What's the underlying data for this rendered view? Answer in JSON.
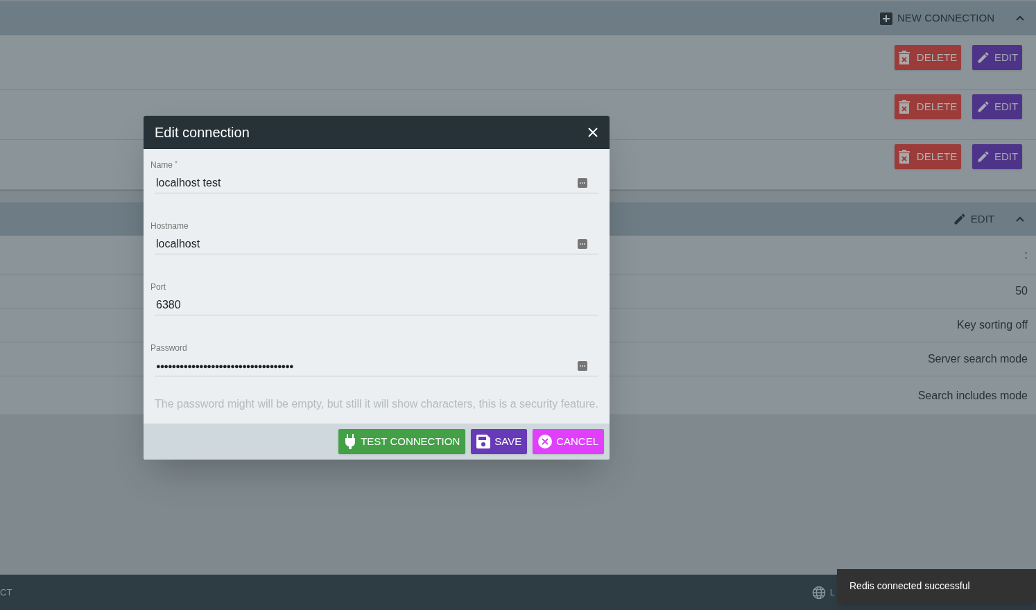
{
  "header": {
    "new_connection": "NEW CONNECTION"
  },
  "connections": [
    {
      "delete": "DELETE",
      "edit": "EDIT"
    },
    {
      "delete": "DELETE",
      "edit": "EDIT"
    },
    {
      "delete": "DELETE",
      "edit": "EDIT"
    }
  ],
  "settings": {
    "edit": "EDIT",
    "rows": [
      ":",
      "50",
      "Key sorting off",
      "Server search mode",
      "Search includes mode"
    ]
  },
  "footer": {
    "left": "CT",
    "right": "L"
  },
  "toast": "Redis connected successful",
  "dialog": {
    "title": "Edit connection",
    "fields": [
      {
        "label": "Name $^{*}$",
        "value": "localhost test",
        "kind": "text"
      },
      {
        "label": "Hostname",
        "value": "localhost",
        "kind": "text"
      },
      {
        "label": "Port",
        "value": "6380",
        "kind": "number"
      },
      {
        "label": "Password",
        "value": "●●●●●●●●●●●●●●●●●●●●●●●●●●●●●●●●●●●",
        "kind": "password"
      }
    ],
    "hint": "The password might will be empty, but still it will show characters, this is a security feature.",
    "buttons": [
      {
        "label": "TEST CONNECTION",
        "kind": "test"
      },
      {
        "label": "SAVE",
        "kind": "save"
      },
      {
        "label": "CANCEL",
        "kind": "cancel"
      }
    ]
  }
}
